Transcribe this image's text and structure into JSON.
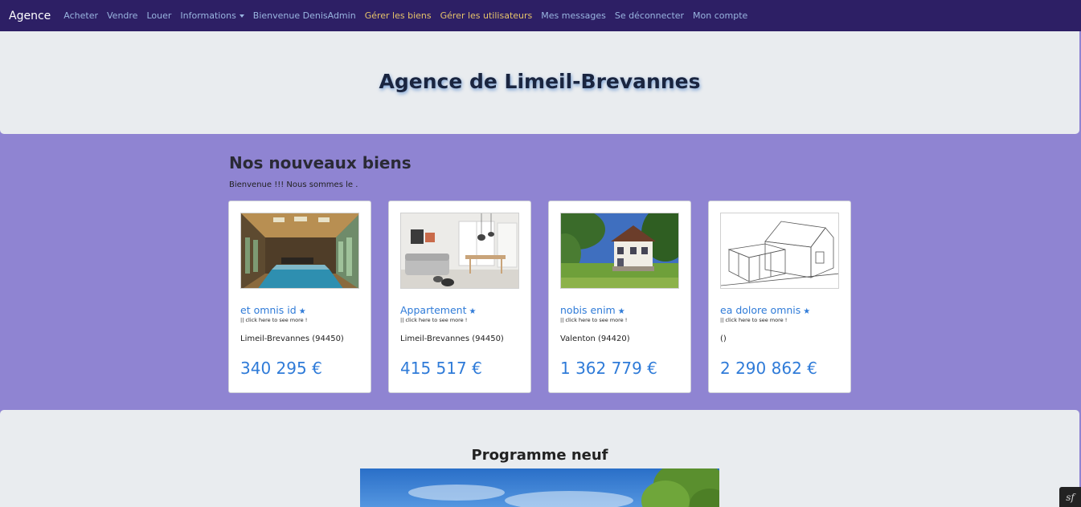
{
  "navbar": {
    "brand": "Agence",
    "items": [
      {
        "label": "Acheter"
      },
      {
        "label": "Vendre"
      },
      {
        "label": "Louer"
      },
      {
        "label": "Informations"
      },
      {
        "label": "Bienvenue DenisAdmin"
      },
      {
        "label": "Gérer les biens"
      },
      {
        "label": "Gérer les utilisateurs"
      },
      {
        "label": "Mes messages"
      },
      {
        "label": "Se déconnecter"
      },
      {
        "label": "Mon compte"
      }
    ],
    "highlight_color": "#e6c36a"
  },
  "hero": {
    "title": "Agence de Limeil-Brevannes"
  },
  "listings": {
    "title": "Nos nouveaux biens",
    "subtitle": "Bienvenue !!! Nous sommes le .",
    "cards": [
      {
        "title": "et omnis id",
        "star": "★",
        "more": "|| click here to see more !",
        "location": "Limeil-Brevannes (94450)",
        "price": "340 295 €",
        "image": "indoor-pool"
      },
      {
        "title": "Appartement",
        "star": "★",
        "more": "|| click here to see more !",
        "location": "Limeil-Brevannes (94450)",
        "price": "415 517 €",
        "image": "living-room"
      },
      {
        "title": "nobis enim",
        "star": "★",
        "more": "|| click here to see more !",
        "location": "Valenton (94420)",
        "price": "1 362 779 €",
        "image": "house-garden"
      },
      {
        "title": "ea dolore omnis",
        "star": "★",
        "more": "|| click here to see more !",
        "location": "()",
        "price": "2 290 862 €",
        "image": "house-sketch"
      }
    ]
  },
  "programme": {
    "title": "Programme neuf",
    "image": "sky-trees"
  },
  "debug_badge": {
    "glyph": "sf"
  },
  "colors": {
    "page_bg": "#8f84d2",
    "navbar_bg": "#2d1f65",
    "link": "#2f7bd8"
  }
}
